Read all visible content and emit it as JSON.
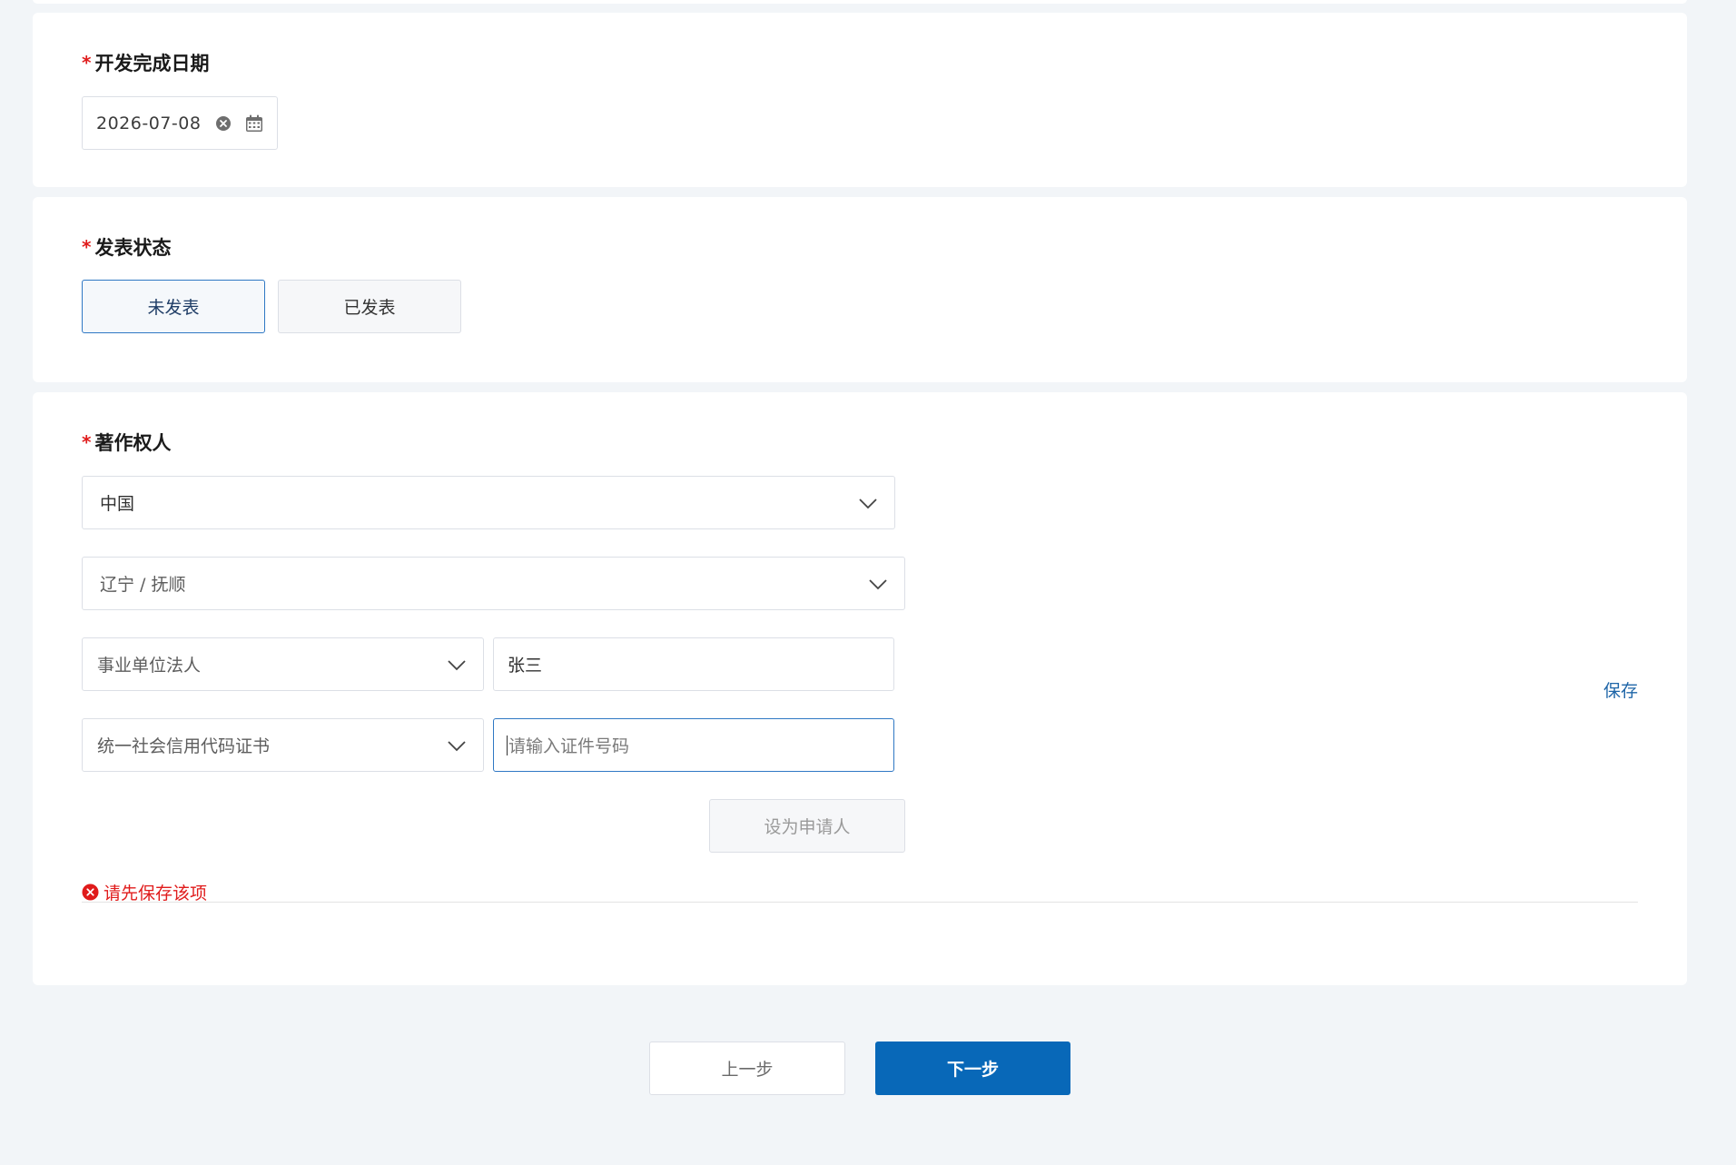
{
  "completion_date": {
    "label": "开发完成日期",
    "value": "2026-07-08",
    "icons": [
      "clear-circle-icon",
      "calendar-icon"
    ]
  },
  "publish_status": {
    "label": "发表状态",
    "options": [
      "未发表",
      "已发表"
    ],
    "selected": "未发表"
  },
  "copyright_holder": {
    "label": "著作权人",
    "country": "中国",
    "region": "辽宁 / 抚顺",
    "holder_type": "事业单位法人",
    "name": "张三",
    "id_type": "统一社会信用代码证书",
    "id_placeholder": "请输入证件号码",
    "set_applicant_label": "设为申请人",
    "save_label": "保存",
    "error_message": "请先保存该项"
  },
  "footer": {
    "prev_label": "上一步",
    "next_label": "下一步"
  },
  "colors": {
    "primary": "#0868b8",
    "required": "#e01b1b",
    "error": "#e01b1b",
    "link": "#1f66a8"
  }
}
